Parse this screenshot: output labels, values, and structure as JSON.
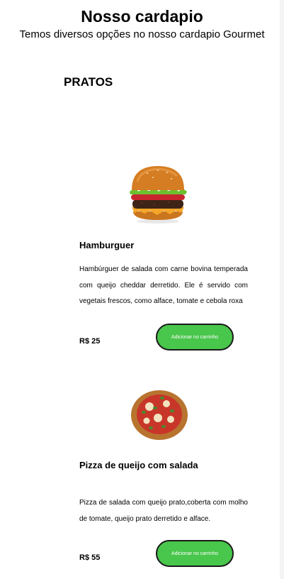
{
  "header": {
    "title": "Nosso cardapio",
    "subtitle": "Temos diversos opções no nosso cardapio Gourmet"
  },
  "section": {
    "title": "PRATOS"
  },
  "products": [
    {
      "name": "Hamburguer",
      "description": "Hambúrguer de salada com carne bovina temperada com queijo cheddar derretido. Ele é servido com vegetais frescos, como alface, tomate e cebola roxa",
      "price": "R$ 25",
      "button_label": "Adicionar no carrinho",
      "image_icon": "hamburger-image"
    },
    {
      "name": "Pizza de queijo com salada",
      "description": "Pizza de salada com queijo prato,coberta com molho de tomate, queijo prato derretido e alface.",
      "price": "R$ 55",
      "button_label": "Adicionar no carrinho",
      "image_icon": "pizza-image"
    }
  ],
  "colors": {
    "button_bg": "#49c64c",
    "button_border": "#1a1a1a",
    "button_text": "#ffffff"
  }
}
